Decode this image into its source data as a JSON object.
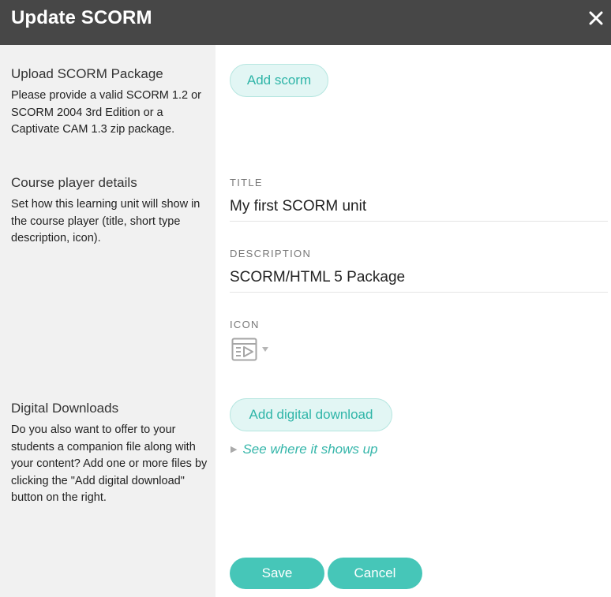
{
  "header": {
    "title": "Update SCORM",
    "close_icon": "close-icon"
  },
  "sections": {
    "upload": {
      "heading": "Upload SCORM Package",
      "description": "Please provide a valid SCORM 1.2 or SCORM 2004 3rd Edition or a Captivate CAM 1.3 zip package.",
      "button_label": "Add scorm"
    },
    "player": {
      "heading": "Course player details",
      "description": "Set how this learning unit will show in the course player (title, short type description, icon).",
      "title_label": "TITLE",
      "title_value": "My first SCORM unit",
      "description_label": "DESCRIPTION",
      "description_value": "SCORM/HTML 5 Package",
      "icon_label": "ICON",
      "icon_name": "video-player-icon"
    },
    "downloads": {
      "heading": "Digital Downloads",
      "description": "Do you also want to offer to your students a companion file along with your content? Add one or more files by clicking the \"Add digital download\" button on the right.",
      "button_label": "Add digital download",
      "disclosure_label": "See where it shows up"
    }
  },
  "footer": {
    "save_label": "Save",
    "cancel_label": "Cancel"
  },
  "colors": {
    "header_bg": "#474747",
    "sidebar_bg": "#f1f1f1",
    "accent": "#46c6b8",
    "pill_bg": "#e2f6f4",
    "link": "#35b6aa"
  }
}
